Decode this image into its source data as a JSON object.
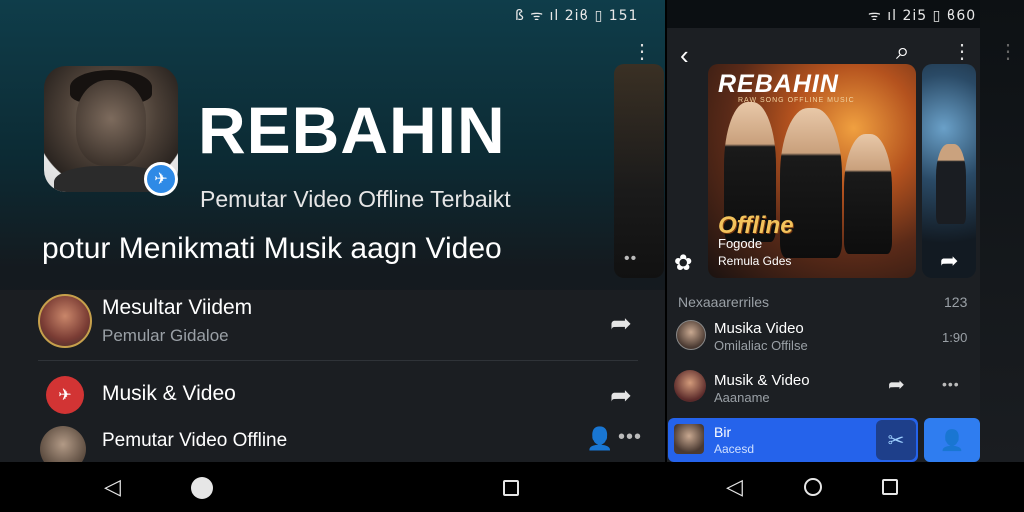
{
  "status": {
    "left": "ß ᯤ ıl 2iϐ ▯ 151",
    "right": "ᯤ ıl 2i5 ▯ ϐ60"
  },
  "left_panel": {
    "app_title": "REBAHIN",
    "app_subtitle": "Pemutar Video Offline Terbaikt",
    "tagline": "potur Menikmati Musik aagn Video",
    "items": [
      {
        "title": "Mesultar Viidem",
        "subtitle": "Pemular Gidaloe",
        "icon": "share-icon"
      },
      {
        "title": "Musik & Video",
        "icon": "share-icon"
      },
      {
        "title": "Pemutar Video Offline",
        "icon": "user-icon"
      }
    ]
  },
  "right_panel": {
    "poster": {
      "title": "REBAHIN",
      "subtitle": "RAW SONG OFFLINE MUSIC",
      "offline_text": "Offline",
      "label": "Fogode",
      "caption": "Remula Gdes"
    },
    "section_label": "Nexaaarerriles",
    "section_count": "123",
    "items": [
      {
        "title": "Musika Video",
        "subtitle": "Omilaliac Offilse",
        "meta": "1:90"
      },
      {
        "title": "Musik & Video",
        "subtitle": "Aaaname"
      }
    ],
    "now_playing": {
      "title": "Bir",
      "subtitle": "Aacesd"
    }
  },
  "icons": {
    "back": "chevron-left-icon",
    "search": "search-icon",
    "menu": "more-vertical-icon",
    "gear": "gear-icon",
    "verified": "badge-icon"
  },
  "colors": {
    "accent": "#2563eb",
    "badge": "#2e8ae6",
    "background": "#1b1e22"
  }
}
